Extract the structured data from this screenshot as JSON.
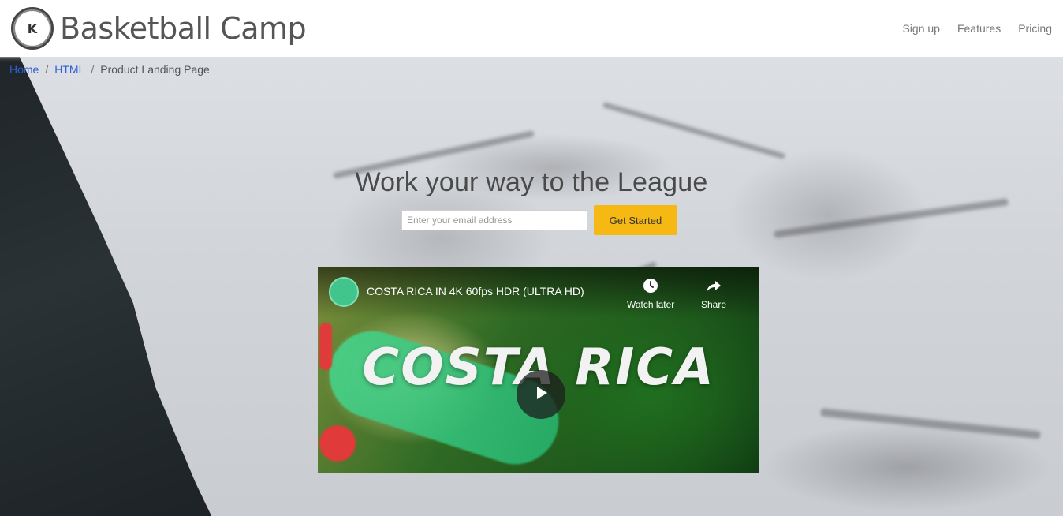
{
  "header": {
    "logo_letter": "K",
    "brand_name": "Basketball Camp",
    "nav": {
      "sign_up": "Sign up",
      "features": "Features",
      "pricing": "Pricing"
    }
  },
  "breadcrumb": {
    "items": [
      {
        "label": "Home"
      },
      {
        "label": "HTML"
      }
    ],
    "current": "Product Landing Page",
    "separator": "/"
  },
  "hero": {
    "title": "Work your way to the League",
    "email_placeholder": "Enter your email address",
    "cta_label": "Get Started"
  },
  "video": {
    "title": "COSTA RICA IN 4K 60fps HDR (ULTRA HD)",
    "watch_later_label": "Watch later",
    "share_label": "Share",
    "overlay_title": "COSTA RICA"
  },
  "colors": {
    "accent_button": "#f6b914",
    "link": "#2f5fd0",
    "channel_avatar": "#42c58d"
  },
  "icons": {
    "logo": "circle-logo-icon",
    "watch_later": "clock-icon",
    "share": "share-arrow-icon",
    "play": "play-icon"
  }
}
